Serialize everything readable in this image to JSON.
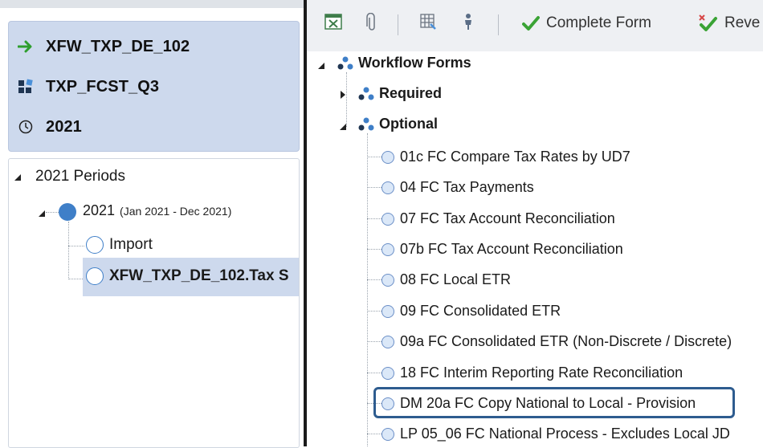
{
  "context": {
    "workflow": "XFW_TXP_DE_102",
    "scenario": "TXP_FCST_Q3",
    "time": "2021"
  },
  "left_tree": {
    "root_label": "2021 Periods",
    "period_label": "2021",
    "period_range": "(Jan 2021 - Dec 2021)",
    "children": [
      "Import",
      "XFW_TXP_DE_102.Tax S"
    ]
  },
  "toolbar": {
    "complete_label": "Complete Form",
    "revert_label": "Reve"
  },
  "right_tree": {
    "root_label": "Workflow Forms",
    "required_label": "Required",
    "optional_label": "Optional",
    "items": [
      "01c FC Compare Tax Rates by UD7",
      "04 FC Tax Payments",
      "07 FC Tax Account Reconciliation",
      "07b FC Tax Account Reconciliation",
      "08 FC Local ETR",
      "09 FC Consolidated ETR",
      "09a FC Consolidated ETR (Non-Discrete / Discrete)",
      "18 FC Interim Reporting Rate Reconciliation",
      "DM 20a FC Copy National to Local - Provision",
      "LP 05_06 FC National Process - Excludes Local JD"
    ]
  },
  "colors": {
    "context_bg": "#cdd9ed",
    "selection_bg": "#cdd9ed",
    "highlight_border": "#2e5c8f",
    "check_green": "#3aa335",
    "arrow_green": "#2e9e2e"
  }
}
